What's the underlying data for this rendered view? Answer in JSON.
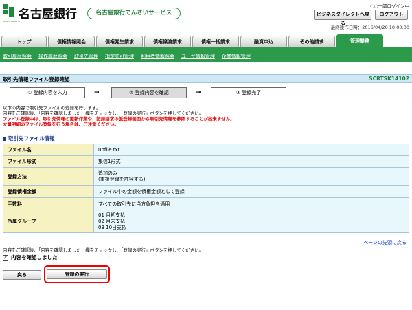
{
  "header": {
    "logo_text": "名古屋銀行",
    "logo_sub": "Bank of NAGOYA",
    "service_name": "名古屋銀行でんさいサービス",
    "login_user": "○○一郎ログイン中",
    "btn_bizdirect": "ビジネスダイレクトへ戻る",
    "btn_logout": "ログアウト",
    "last_operation": "最終操作日時：2016/04/20 10:00:00"
  },
  "tabs": [
    {
      "label": "トップ",
      "active": false
    },
    {
      "label": "債権情報照会",
      "active": false
    },
    {
      "label": "債権発生請求",
      "active": false
    },
    {
      "label": "債権譲渡請求",
      "active": false
    },
    {
      "label": "債権一括請求",
      "active": false
    },
    {
      "label": "融資申込",
      "active": false
    },
    {
      "label": "その他請求",
      "active": false
    },
    {
      "label": "管理業務",
      "active": true
    }
  ],
  "subnav": [
    "取引履歴照会",
    "操作履歴照会",
    "取引先管理",
    "指定許可管理",
    "利用者情報照会",
    "ユーザ情報管理",
    "企業情報管理"
  ],
  "page": {
    "title": "取引先情報ファイル登録確認",
    "code": "SCRTSK14102"
  },
  "steps": [
    "① 登録内容を入力",
    "② 登録内容を確認",
    "③ 登録完了"
  ],
  "messages": {
    "line1": "以下の内容で取引先ファイルの登録を行います。",
    "line2": "内容をご確認後、「内容を確認しました」欄をチェックし、「登録の実行」ボタンを押してください。",
    "warn1": "ファイル登録中は、取引先情報の更新作業や、記録請求の仮登録画面から取引先情報を参照することが出来ません。",
    "warn2": "大量明細のファイル登録を行う場合は、ご注意ください。"
  },
  "section_title": "取引先ファイル情報",
  "rows": [
    {
      "label": "ファイル名",
      "value": "upfile.txt"
    },
    {
      "label": "ファイル形式",
      "value": "集信1形式"
    },
    {
      "label": "登録方法",
      "value": "追加のみ\n(重複登録を許容する)"
    },
    {
      "label": "登録債権金額",
      "value": "ファイル中の金額を債権金額として登録"
    },
    {
      "label": "手数料",
      "value": "すべての取引先に当方負担を適用"
    },
    {
      "label": "所属グループ",
      "value": "01 月初支払\n02 月末支払\n03 10日支払"
    }
  ],
  "page_top_link": "ページの先頭に戻る",
  "confirm_message": "内容をご確認後、「内容を確認しました」欄をチェックし、「登録の実行」ボタンを押してください。",
  "confirm_checkbox_label": "内容を確認しました",
  "confirm_checked": true,
  "buttons": {
    "back": "戻る",
    "execute": "登録の実行"
  },
  "colors": {
    "brand_green": "#2b9a4b",
    "warning_red": "#dd0000",
    "highlight_red": "#ee0000"
  }
}
